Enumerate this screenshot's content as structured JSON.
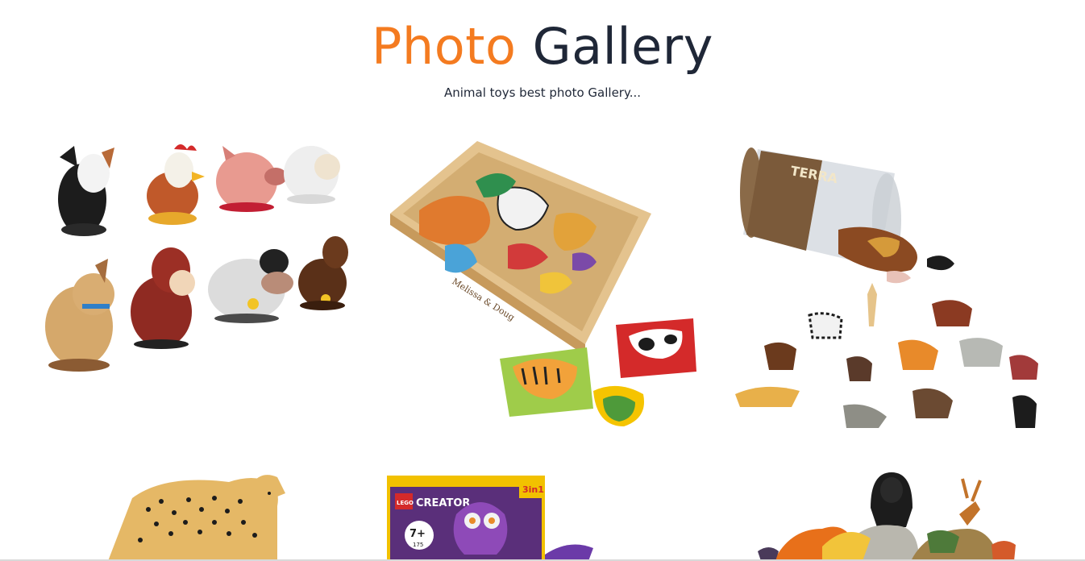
{
  "header": {
    "title_accent": "Photo",
    "title_main": "Gallery",
    "subtitle": "Animal toys best photo Gallery..."
  },
  "colors": {
    "accent": "#f47b20",
    "text_dark": "#1f2737",
    "background": "#ffffff"
  },
  "gallery": {
    "photos": [
      {
        "subject": "farm-animal-figures"
      },
      {
        "subject": "wooden-animal-magnets-box",
        "brand_text": "Melissa & Doug"
      },
      {
        "subject": "animal-figures-tube",
        "brand_text": "TERRA"
      },
      {
        "subject": "cheetah-figure"
      },
      {
        "subject": "lego-creator-box",
        "brand_text": "LEGO",
        "line_text": "CREATOR",
        "age_text": "7+",
        "set_text": "3in1",
        "count_text": "175"
      },
      {
        "subject": "jungle-animal-figures-pile"
      }
    ]
  }
}
